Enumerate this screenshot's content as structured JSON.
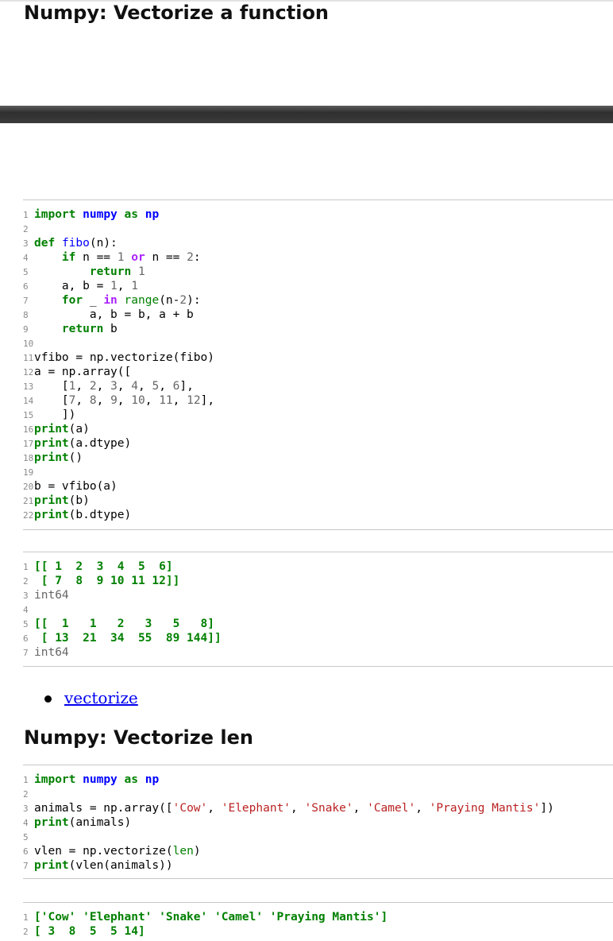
{
  "title1": "Numpy: Vectorize a function",
  "title2": "Numpy: Vectorize len",
  "link_label": "vectorize",
  "code1": [
    [
      {
        "t": "import",
        "c": "kw"
      },
      {
        "t": " "
      },
      {
        "t": "numpy",
        "c": "nm"
      },
      {
        "t": " "
      },
      {
        "t": "as",
        "c": "kw"
      },
      {
        "t": " "
      },
      {
        "t": "np",
        "c": "nm"
      }
    ],
    [],
    [
      {
        "t": "def",
        "c": "kw"
      },
      {
        "t": " "
      },
      {
        "t": "fibo",
        "c": "fn"
      },
      {
        "t": "(n):"
      }
    ],
    [
      {
        "t": "    "
      },
      {
        "t": "if",
        "c": "kw"
      },
      {
        "t": " n == "
      },
      {
        "t": "1",
        "c": "num"
      },
      {
        "t": " "
      },
      {
        "t": "or",
        "c": "op"
      },
      {
        "t": " n == "
      },
      {
        "t": "2",
        "c": "num"
      },
      {
        "t": ":"
      }
    ],
    [
      {
        "t": "        "
      },
      {
        "t": "return",
        "c": "kw"
      },
      {
        "t": " "
      },
      {
        "t": "1",
        "c": "num"
      }
    ],
    [
      {
        "t": "    a, b = "
      },
      {
        "t": "1",
        "c": "num"
      },
      {
        "t": ", "
      },
      {
        "t": "1",
        "c": "num"
      }
    ],
    [
      {
        "t": "    "
      },
      {
        "t": "for",
        "c": "kw"
      },
      {
        "t": " _ "
      },
      {
        "t": "in",
        "c": "op"
      },
      {
        "t": " "
      },
      {
        "t": "range",
        "c": "bi"
      },
      {
        "t": "(n-"
      },
      {
        "t": "2",
        "c": "num"
      },
      {
        "t": "):"
      }
    ],
    [
      {
        "t": "        a, b = b, a + b"
      }
    ],
    [
      {
        "t": "    "
      },
      {
        "t": "return",
        "c": "kw"
      },
      {
        "t": " b"
      }
    ],
    [],
    [
      {
        "t": "vfibo = np.vectorize(fibo)"
      }
    ],
    [
      {
        "t": "a = np.array(["
      }
    ],
    [
      {
        "t": "    ["
      },
      {
        "t": "1",
        "c": "num"
      },
      {
        "t": ", "
      },
      {
        "t": "2",
        "c": "num"
      },
      {
        "t": ", "
      },
      {
        "t": "3",
        "c": "num"
      },
      {
        "t": ", "
      },
      {
        "t": "4",
        "c": "num"
      },
      {
        "t": ", "
      },
      {
        "t": "5",
        "c": "num"
      },
      {
        "t": ", "
      },
      {
        "t": "6",
        "c": "num"
      },
      {
        "t": "],"
      }
    ],
    [
      {
        "t": "    ["
      },
      {
        "t": "7",
        "c": "num"
      },
      {
        "t": ", "
      },
      {
        "t": "8",
        "c": "num"
      },
      {
        "t": ", "
      },
      {
        "t": "9",
        "c": "num"
      },
      {
        "t": ", "
      },
      {
        "t": "10",
        "c": "num"
      },
      {
        "t": ", "
      },
      {
        "t": "11",
        "c": "num"
      },
      {
        "t": ", "
      },
      {
        "t": "12",
        "c": "num"
      },
      {
        "t": "],"
      }
    ],
    [
      {
        "t": "    ])"
      }
    ],
    [
      {
        "t": "print",
        "c": "kw"
      },
      {
        "t": "(a)"
      }
    ],
    [
      {
        "t": "print",
        "c": "kw"
      },
      {
        "t": "(a.dtype)"
      }
    ],
    [
      {
        "t": "print",
        "c": "kw"
      },
      {
        "t": "()"
      }
    ],
    [],
    [
      {
        "t": "b = vfibo(a)"
      }
    ],
    [
      {
        "t": "print",
        "c": "kw"
      },
      {
        "t": "(b)"
      }
    ],
    [
      {
        "t": "print",
        "c": "kw"
      },
      {
        "t": "(b.dtype)"
      }
    ]
  ],
  "output1": [
    [
      {
        "t": "[[ 1  2  3  4  5  6]",
        "c": "outtxt"
      }
    ],
    [
      {
        "t": " [ 7  8  9 10 11 12]]",
        "c": "outtxt"
      }
    ],
    [
      {
        "t": "int64",
        "c": "outnum"
      }
    ],
    [],
    [
      {
        "t": "[[  1   1   2   3   5   8]",
        "c": "outtxt"
      }
    ],
    [
      {
        "t": " [ 13  21  34  55  89 144]]",
        "c": "outtxt"
      }
    ],
    [
      {
        "t": "int64",
        "c": "outnum"
      }
    ]
  ],
  "code2": [
    [
      {
        "t": "import",
        "c": "kw"
      },
      {
        "t": " "
      },
      {
        "t": "numpy",
        "c": "nm"
      },
      {
        "t": " "
      },
      {
        "t": "as",
        "c": "kw"
      },
      {
        "t": " "
      },
      {
        "t": "np",
        "c": "nm"
      }
    ],
    [],
    [
      {
        "t": "animals = np.array(["
      },
      {
        "t": "'Cow'",
        "c": "str"
      },
      {
        "t": ", "
      },
      {
        "t": "'Elephant'",
        "c": "str"
      },
      {
        "t": ", "
      },
      {
        "t": "'Snake'",
        "c": "str"
      },
      {
        "t": ", "
      },
      {
        "t": "'Camel'",
        "c": "str"
      },
      {
        "t": ", "
      },
      {
        "t": "'Praying Mantis'",
        "c": "str"
      },
      {
        "t": "])"
      }
    ],
    [
      {
        "t": "print",
        "c": "kw"
      },
      {
        "t": "(animals)"
      }
    ],
    [],
    [
      {
        "t": "vlen = np.vectorize("
      },
      {
        "t": "len",
        "c": "bi"
      },
      {
        "t": ")"
      }
    ],
    [
      {
        "t": "print",
        "c": "kw"
      },
      {
        "t": "(vlen(animals))"
      }
    ]
  ],
  "output2": [
    [
      {
        "t": "['Cow' 'Elephant' 'Snake' 'Camel' 'Praying Mantis']",
        "c": "outtxt"
      }
    ],
    [
      {
        "t": "[ 3  8  5  5 14]",
        "c": "outtxt"
      }
    ]
  ]
}
